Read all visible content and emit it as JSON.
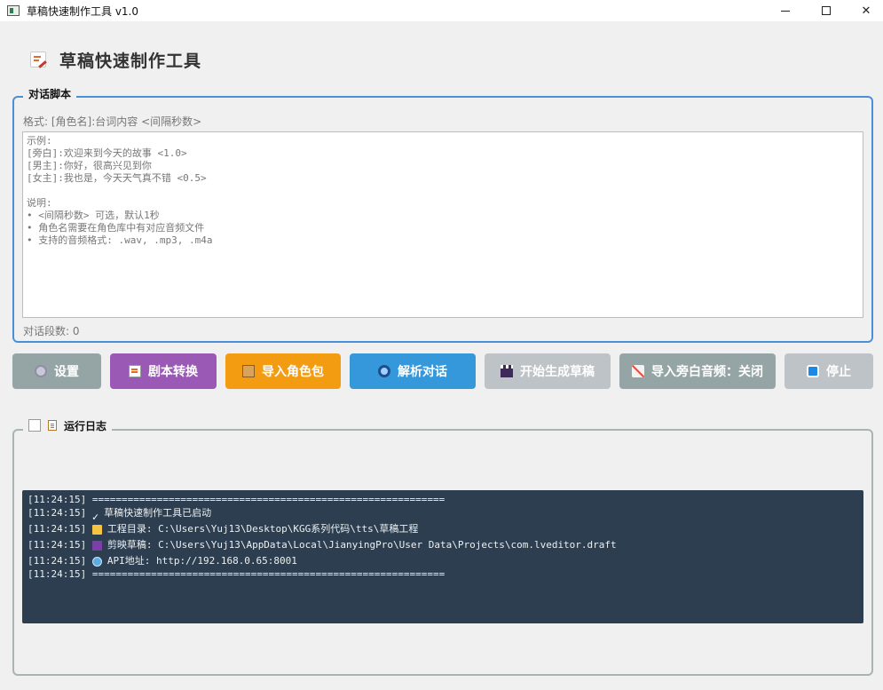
{
  "window": {
    "title": "草稿快速制作工具 v1.0",
    "controls": {
      "minimize": "",
      "maximize": "",
      "close": "✕"
    }
  },
  "header": {
    "title": "草稿快速制作工具",
    "icon": "memo-icon"
  },
  "script_group": {
    "legend": "对话脚本",
    "format_hint": "格式: [角色名]:台词内容 <间隔秒数>",
    "textarea_lines": [
      "示例:",
      "[旁白]:欢迎来到今天的故事 <1.0>",
      "[男主]:你好，很高兴见到你",
      "[女主]:我也是，今天天气真不错 <0.5>",
      "",
      "说明:",
      "• <间隔秒数> 可选，默认1秒",
      "• 角色名需要在角色库中有对应音频文件",
      "• 支持的音频格式: .wav, .mp3, .m4a"
    ],
    "dialog_count": "对话段数: 0"
  },
  "buttons": {
    "settings": "设置",
    "convert": "剧本转换",
    "import_role": "导入角色包",
    "parse": "解析对话",
    "generate": "开始生成草稿",
    "narration": "导入旁白音频：关闭",
    "stop": "停止"
  },
  "log_group": {
    "legend": "运行日志",
    "lines": [
      {
        "time": "[11:24:15]",
        "icon": "",
        "text": "============================================================"
      },
      {
        "time": "[11:24:15]",
        "icon": "check",
        "text": "草稿快速制作工具已启动"
      },
      {
        "time": "[11:24:15]",
        "icon": "folder",
        "text": "工程目录: C:\\Users\\Yuj13\\Desktop\\KGG系列代码\\tts\\草稿工程"
      },
      {
        "time": "[11:24:15]",
        "icon": "clapper",
        "text": "剪映草稿: C:\\Users\\Yuj13\\AppData\\Local\\JianyingPro\\User Data\\Projects\\com.lveditor.draft"
      },
      {
        "time": "[11:24:15]",
        "icon": "globe",
        "text": "API地址: http://192.168.0.65:8001"
      },
      {
        "time": "[11:24:15]",
        "icon": "",
        "text": "============================================================"
      }
    ]
  },
  "colors": {
    "script_border": "#4a90d9",
    "settings": "#95a5a6",
    "convert": "#9b59b6",
    "import_role": "#f39c12",
    "parse": "#3498db",
    "generate": "#bdc3c7",
    "narration": "#95a5a6",
    "stop": "#bdc3c7",
    "log_bg": "#2c3e50"
  }
}
